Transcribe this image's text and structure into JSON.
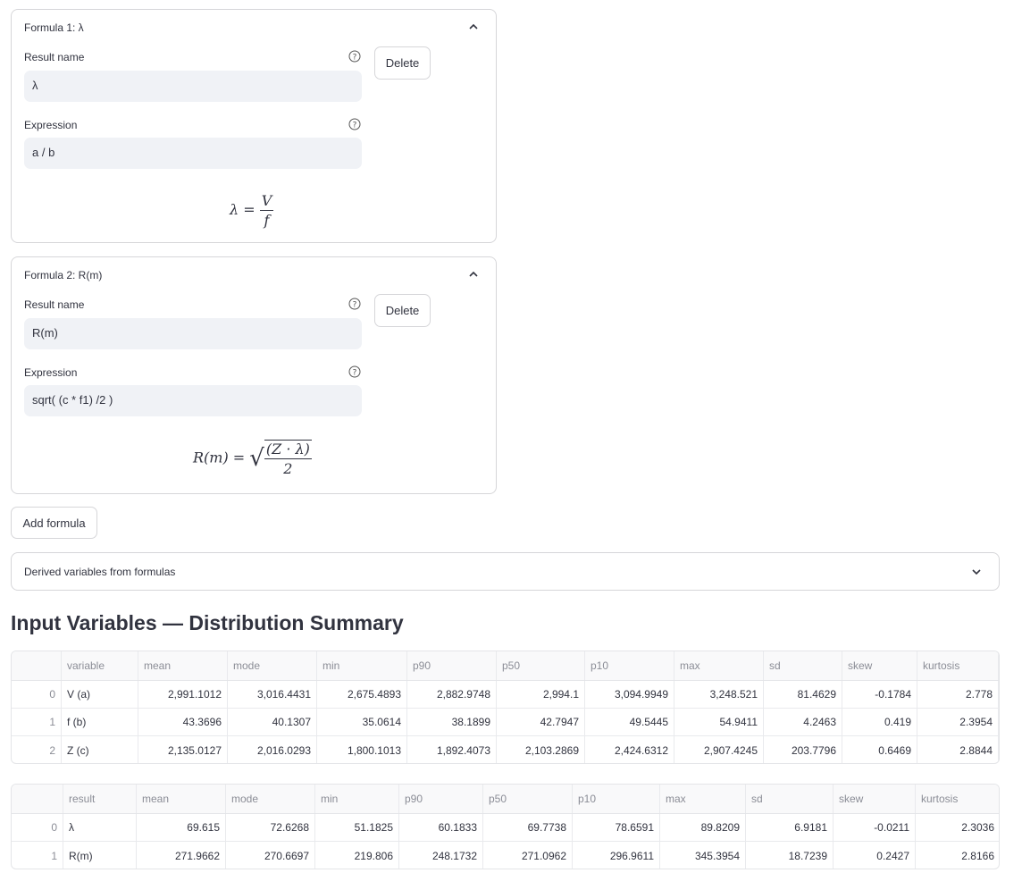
{
  "formulas": [
    {
      "title": "Formula 1: λ",
      "result_label": "Result name",
      "result_value": "λ",
      "expression_label": "Expression",
      "expression_value": "a / b",
      "delete_label": "Delete",
      "rendered": {
        "lhs": "λ",
        "num": "V",
        "den": "f"
      }
    },
    {
      "title": "Formula 2: R(m)",
      "result_label": "Result name",
      "result_value": "R(m)",
      "expression_label": "Expression",
      "expression_value": "sqrt( (c * f1) /2 )",
      "delete_label": "Delete",
      "rendered": {
        "lhs": "R(m)",
        "num": "(Z · λ)",
        "den": "2"
      }
    }
  ],
  "add_formula_label": "Add formula",
  "derived_expander_label": "Derived variables from formulas",
  "input_section_title": "Input Variables — Distribution Summary",
  "input_table": {
    "columns": [
      "",
      "variable",
      "mean",
      "mode",
      "min",
      "p90",
      "p50",
      "p10",
      "max",
      "sd",
      "skew",
      "kurtosis"
    ],
    "rows": [
      [
        "0",
        "V (a)",
        "2,991.1012",
        "3,016.4431",
        "2,675.4893",
        "2,882.9748",
        "2,994.1",
        "3,094.9949",
        "3,248.521",
        "81.4629",
        "-0.1784",
        "2.778"
      ],
      [
        "1",
        "f (b)",
        "43.3696",
        "40.1307",
        "35.0614",
        "38.1899",
        "42.7947",
        "49.5445",
        "54.9411",
        "4.2463",
        "0.419",
        "2.3954"
      ],
      [
        "2",
        "Z (c)",
        "2,135.0127",
        "2,016.0293",
        "1,800.1013",
        "1,892.4073",
        "2,103.2869",
        "2,424.6312",
        "2,907.4245",
        "203.7796",
        "0.6469",
        "2.8844"
      ]
    ]
  },
  "result_table": {
    "columns": [
      "",
      "result",
      "mean",
      "mode",
      "min",
      "p90",
      "p50",
      "p10",
      "max",
      "sd",
      "skew",
      "kurtosis"
    ],
    "rows": [
      [
        "0",
        "λ",
        "69.615",
        "72.6268",
        "51.1825",
        "60.1833",
        "69.7738",
        "78.6591",
        "89.8209",
        "6.9181",
        "-0.0211",
        "2.3036"
      ],
      [
        "1",
        "R(m)",
        "271.9662",
        "270.6697",
        "219.806",
        "248.1732",
        "271.0962",
        "296.9611",
        "345.3954",
        "18.7239",
        "0.2427",
        "2.8166"
      ]
    ]
  }
}
